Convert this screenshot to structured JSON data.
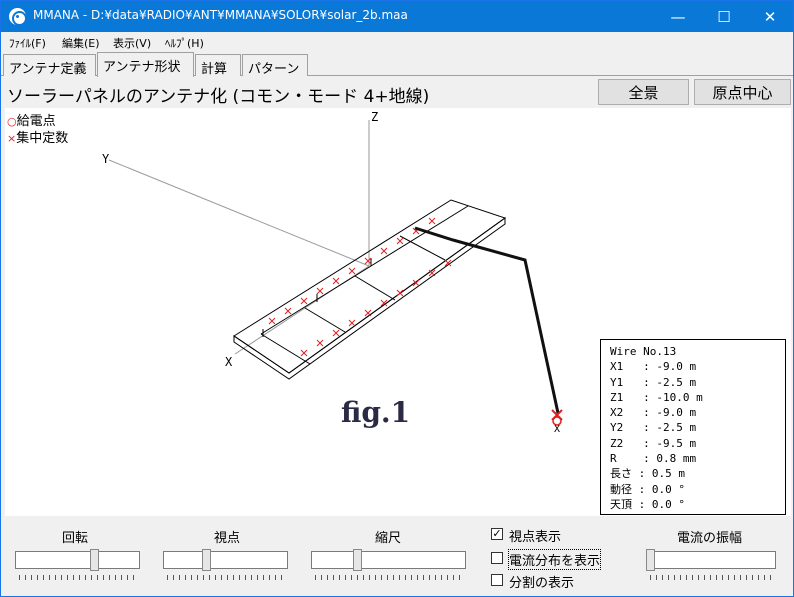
{
  "window": {
    "title": "MMANA - D:¥data¥RADIO¥ANT¥MMANA¥SOLOR¥solar_2b.maa",
    "minimize": "—",
    "maximize": "☐",
    "close": "✕"
  },
  "menu": [
    "ﾌｧｲﾙ(F)",
    "編集(E)",
    "表示(V)",
    "ﾍﾙﾌﾟ(H)"
  ],
  "tabs": [
    "アンテナ定義",
    "アンテナ形状",
    "計算",
    "パターン"
  ],
  "active_tab": "アンテナ形状",
  "heading": "ソーラーパネルのアンテナ化 (コモン・モード 4+地線)",
  "buttons": {
    "zenkei": "全景",
    "genten": "原点中心"
  },
  "legend": {
    "feed": "給電点",
    "feed_marker": "○",
    "load": "集中定数",
    "load_marker": "×"
  },
  "axes": {
    "x": "X",
    "y": "Y",
    "z": "Z"
  },
  "figure_label": "fig.1",
  "wire_info": [
    "Wire No.13",
    "X1   : -9.0 m",
    "Y1   : -2.5 m",
    "Z1   : -10.0 m",
    "X2   : -9.0 m",
    "Y2   : -2.5 m",
    "Z2   : -9.5 m",
    "R    : 0.8 mm",
    "長さ : 0.5 m",
    "動径 : 0.0 °",
    "天頂 : 0.0 °"
  ],
  "controls": {
    "rotate": "回転",
    "view": "視点",
    "scale": "縮尺",
    "current_amp": "電流の振幅"
  },
  "checks": {
    "show_view": {
      "label": "視点表示",
      "checked": true,
      "mark": "✓"
    },
    "show_current": {
      "label": "電流分布を表示",
      "checked": false
    },
    "show_div": {
      "label": "分割の表示",
      "checked": false
    }
  },
  "colors": {
    "titlebar": "#0a78d7",
    "wire": "#000000",
    "load_marker": "#e02020",
    "feed_marker": "#e02020"
  }
}
